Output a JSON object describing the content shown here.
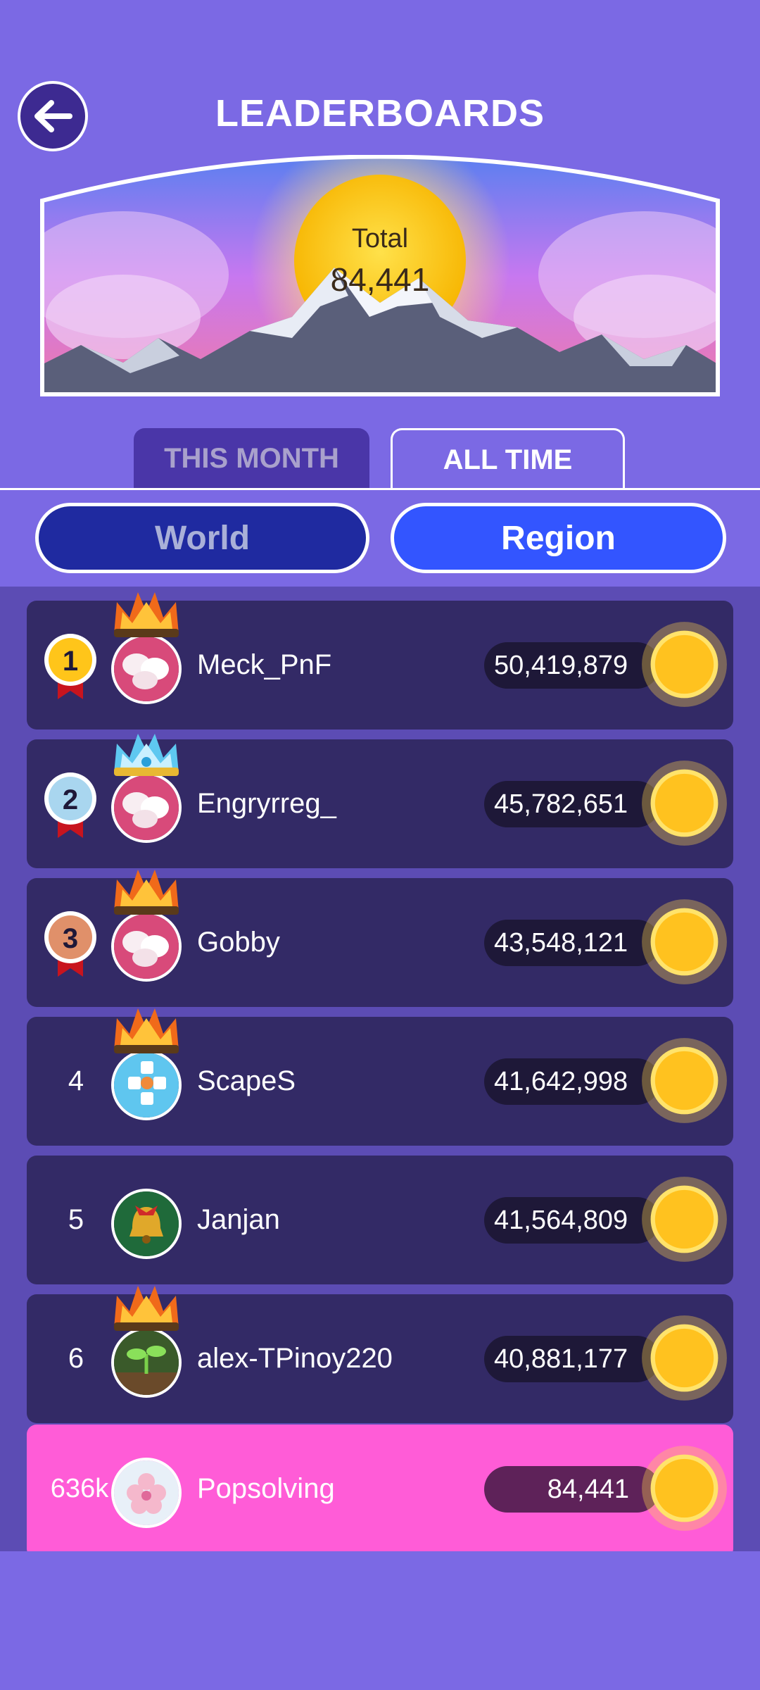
{
  "header": {
    "title": "LEADERBOARDS"
  },
  "banner": {
    "total_label": "Total",
    "total_value": "84,441"
  },
  "tabs": [
    {
      "label": "THIS MONTH",
      "active": false
    },
    {
      "label": "ALL TIME",
      "active": true
    }
  ],
  "scope": [
    {
      "label": "World",
      "active": false
    },
    {
      "label": "Region",
      "active": true
    }
  ],
  "leaderboard": [
    {
      "rank": "1",
      "name": "Meck_PnF",
      "score": "50,419,879",
      "medal": "gold",
      "crown": "fire-crown",
      "avatar": "white-flowers"
    },
    {
      "rank": "2",
      "name": "Engryrreg_",
      "score": "45,782,651",
      "medal": "silver",
      "crown": "ice-crown",
      "avatar": "white-flowers"
    },
    {
      "rank": "3",
      "name": "Gobby",
      "score": "43,548,121",
      "medal": "bronze",
      "crown": "fire-crown",
      "avatar": "white-flowers"
    },
    {
      "rank": "4",
      "name": "ScapeS",
      "score": "41,642,998",
      "medal": "",
      "crown": "fire-crown",
      "avatar": "word-logo"
    },
    {
      "rank": "5",
      "name": "Janjan",
      "score": "41,564,809",
      "medal": "",
      "crown": "",
      "avatar": "bell"
    },
    {
      "rank": "6",
      "name": "alex-TPinoy220",
      "score": "40,881,177",
      "medal": "",
      "crown": "fire-crown",
      "avatar": "sprout"
    }
  ],
  "current_user": {
    "rank": "636k",
    "name": "Popsolving",
    "score": "84,441",
    "avatar": "cherry-blossom"
  },
  "colors": {
    "background": "#7b69e4",
    "row": "#332a66",
    "highlight_row": "#ff5cd7",
    "region_button": "#3355ff",
    "world_button": "#1f2aa0"
  }
}
